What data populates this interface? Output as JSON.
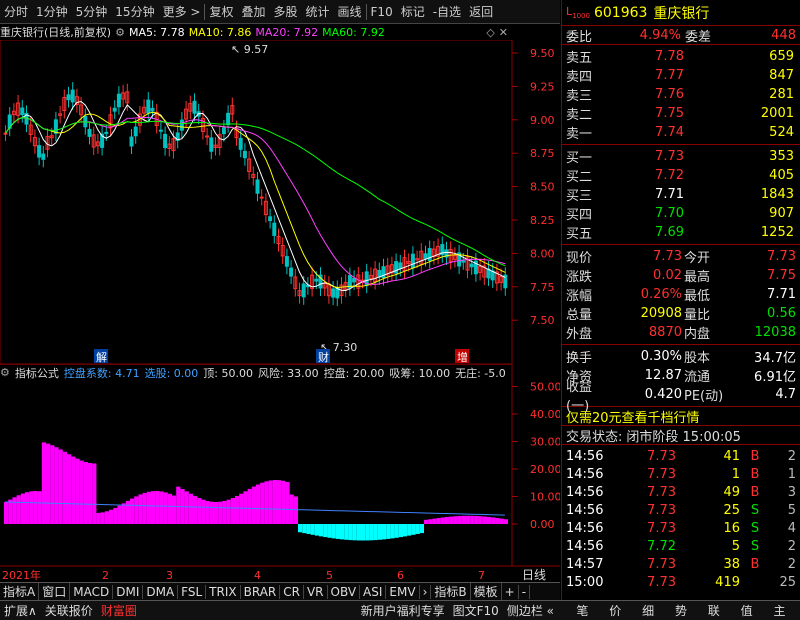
{
  "toolbar": {
    "items": [
      "分时",
      "1分钟",
      "5分钟",
      "15分钟",
      "更多 >",
      "复权",
      "叠加",
      "多股",
      "统计",
      "画线",
      "F10",
      "标记",
      "-自选",
      "返回"
    ]
  },
  "chart_info": {
    "title": "重庆银行(日线,前复权)",
    "ma5": "MA5: 7.78",
    "ma10": "MA10: 7.86",
    "ma20": "MA20: 7.92",
    "ma60": "MA60: 7.92",
    "high_label": "9.57",
    "low_label": "7.30",
    "price_ticks": [
      "9.50",
      "9.25",
      "9.00",
      "8.75",
      "8.50",
      "8.25",
      "8.00",
      "7.75",
      "7.50"
    ],
    "markers": [
      "解",
      "财",
      "增"
    ]
  },
  "indicator": {
    "name": "指标公式",
    "coef": "控盘系数: 4.71",
    "select": "选股: 0.00",
    "top": "顶: 50.00",
    "risk": "风险: 33.00",
    "control": "控盘: 20.00",
    "absorb": "吸筹: 10.00",
    "nozhuang": "无庄: -5.0",
    "ticks": [
      "50.00",
      "40.00",
      "30.00",
      "20.00",
      "10.00",
      "0.00"
    ]
  },
  "timeaxis": {
    "labels": [
      "2021年",
      "2",
      "3",
      "4",
      "5",
      "6",
      "7"
    ],
    "period": "日线"
  },
  "tabs": [
    "指标A",
    "窗口",
    "MACD",
    "DMI",
    "DMA",
    "FSL",
    "TRIX",
    "BRAR",
    "CR",
    "VR",
    "OBV",
    "ASI",
    "EMV",
    "›",
    "指标B",
    "模板",
    "+",
    "-"
  ],
  "bottom": {
    "items": [
      "扩展∧",
      "关联报价",
      "财富圈",
      "新用户福利专享",
      "图文F10",
      "侧边栏 «"
    ],
    "right_items": [
      "笔",
      "价",
      "细",
      "势",
      "联",
      "值",
      "主"
    ]
  },
  "quote": {
    "code": "601963",
    "name": "重庆银行",
    "weibi_label": "委比",
    "weibi": "4.94%",
    "weicha_label": "委差",
    "weicha": "448",
    "sells": [
      {
        "label": "卖五",
        "price": "7.78",
        "vol": "659"
      },
      {
        "label": "卖四",
        "price": "7.77",
        "vol": "847"
      },
      {
        "label": "卖三",
        "price": "7.76",
        "vol": "281"
      },
      {
        "label": "卖二",
        "price": "7.75",
        "vol": "2001"
      },
      {
        "label": "卖一",
        "price": "7.74",
        "vol": "524"
      }
    ],
    "buys": [
      {
        "label": "买一",
        "price": "7.73",
        "vol": "353"
      },
      {
        "label": "买二",
        "price": "7.72",
        "vol": "405"
      },
      {
        "label": "买三",
        "price": "7.71",
        "vol": "1843"
      },
      {
        "label": "买四",
        "price": "7.70",
        "vol": "907"
      },
      {
        "label": "买五",
        "price": "7.69",
        "vol": "1252"
      }
    ],
    "stats": [
      {
        "l1": "现价",
        "v1": "7.73",
        "l2": "今开",
        "v2": "7.73"
      },
      {
        "l1": "涨跌",
        "v1": "0.02",
        "l2": "最高",
        "v2": "7.75"
      },
      {
        "l1": "涨幅",
        "v1": "0.26%",
        "l2": "最低",
        "v2": "7.71"
      },
      {
        "l1": "总量",
        "v1": "20908",
        "l2": "量比",
        "v2": "0.56"
      },
      {
        "l1": "外盘",
        "v1": "8870",
        "l2": "内盘",
        "v2": "12038"
      }
    ],
    "stats2": [
      {
        "l1": "换手",
        "v1": "0.30%",
        "l2": "股本",
        "v2": "34.7亿"
      },
      {
        "l1": "净资",
        "v1": "12.87",
        "l2": "流通",
        "v2": "6.91亿"
      },
      {
        "l1": "收益(一)",
        "v1": "0.420",
        "l2": "PE(动)",
        "v2": "4.7"
      }
    ],
    "promo": "仅需20元查看千档行情",
    "status_label": "交易状态:",
    "status": "闭市阶段 15:00:05",
    "ticks": [
      {
        "t": "14:56",
        "p": "7.73",
        "v": "41",
        "d": "B",
        "n": "2"
      },
      {
        "t": "14:56",
        "p": "7.73",
        "v": "1",
        "d": "B",
        "n": "1"
      },
      {
        "t": "14:56",
        "p": "7.73",
        "v": "49",
        "d": "B",
        "n": "3"
      },
      {
        "t": "14:56",
        "p": "7.73",
        "v": "25",
        "d": "S",
        "n": "5"
      },
      {
        "t": "14:56",
        "p": "7.73",
        "v": "16",
        "d": "S",
        "n": "4"
      },
      {
        "t": "14:56",
        "p": "7.72",
        "v": "5",
        "d": "S",
        "n": "2"
      },
      {
        "t": "14:57",
        "p": "7.73",
        "v": "38",
        "d": "B",
        "n": "2"
      },
      {
        "t": "15:00",
        "p": "7.73",
        "v": "419",
        "d": "",
        "n": "25"
      }
    ]
  }
}
